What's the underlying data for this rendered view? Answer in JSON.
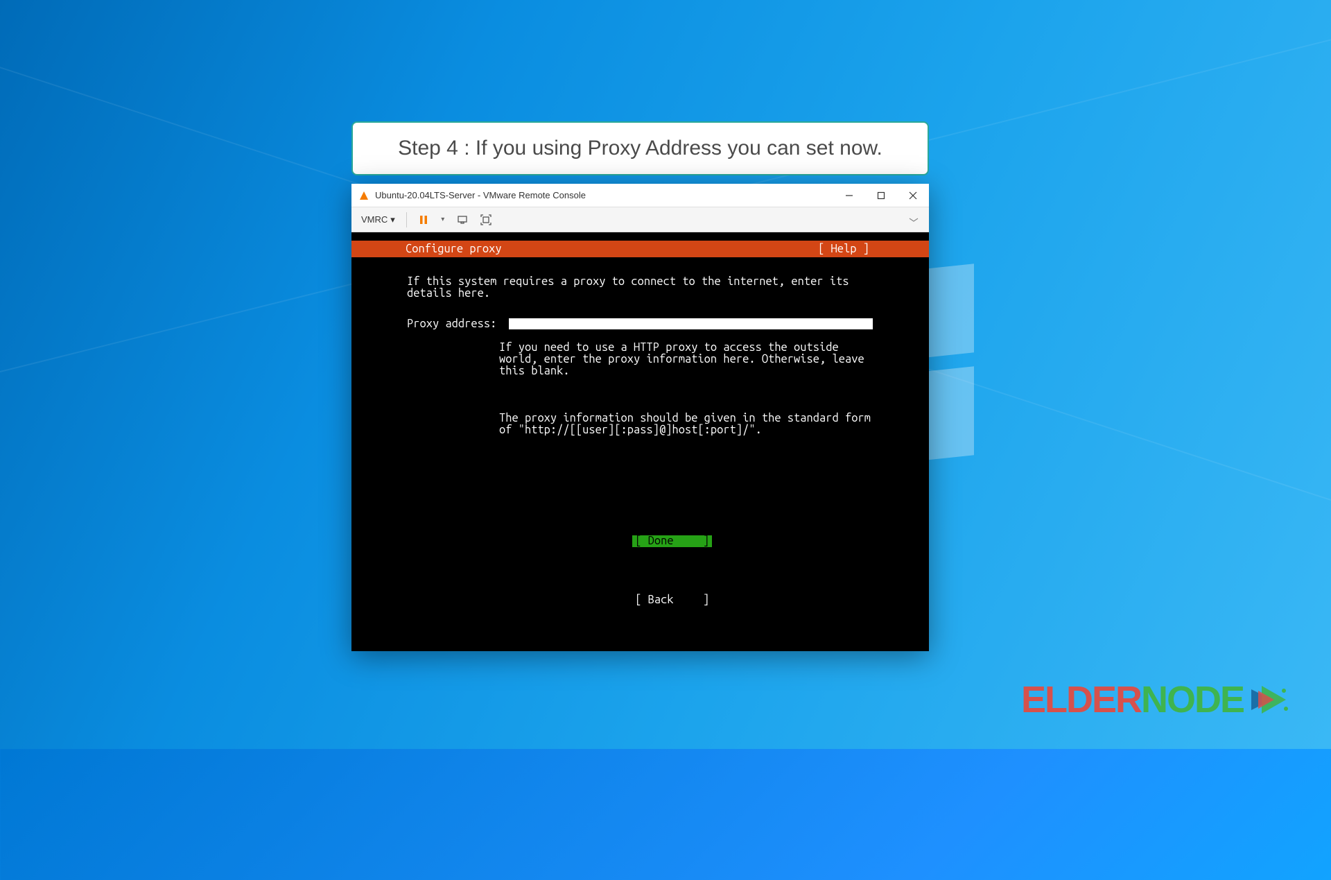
{
  "banner": {
    "text": "Step 4 : If you using Proxy Address you can set now."
  },
  "window": {
    "title": "Ubuntu-20.04LTS-Server - VMware Remote Console"
  },
  "toolbar": {
    "menu_label": "VMRC"
  },
  "installer": {
    "header_title": "Configure proxy",
    "help_label": "[ Help ]",
    "intro": "If this system requires a proxy to connect to the internet, enter its details here.",
    "field_label": "Proxy address:",
    "proxy_value": "",
    "hint1": "If you need to use a HTTP proxy to access the outside world, enter the proxy information here. Otherwise, leave this blank.",
    "hint2": "The proxy information should be given in the standard form of \"http://[[user][:pass]@]host[:port]/\".",
    "done_label": "Done",
    "back_label": "Back"
  },
  "brand": {
    "part1": "ELDER",
    "part2": "NODE"
  }
}
